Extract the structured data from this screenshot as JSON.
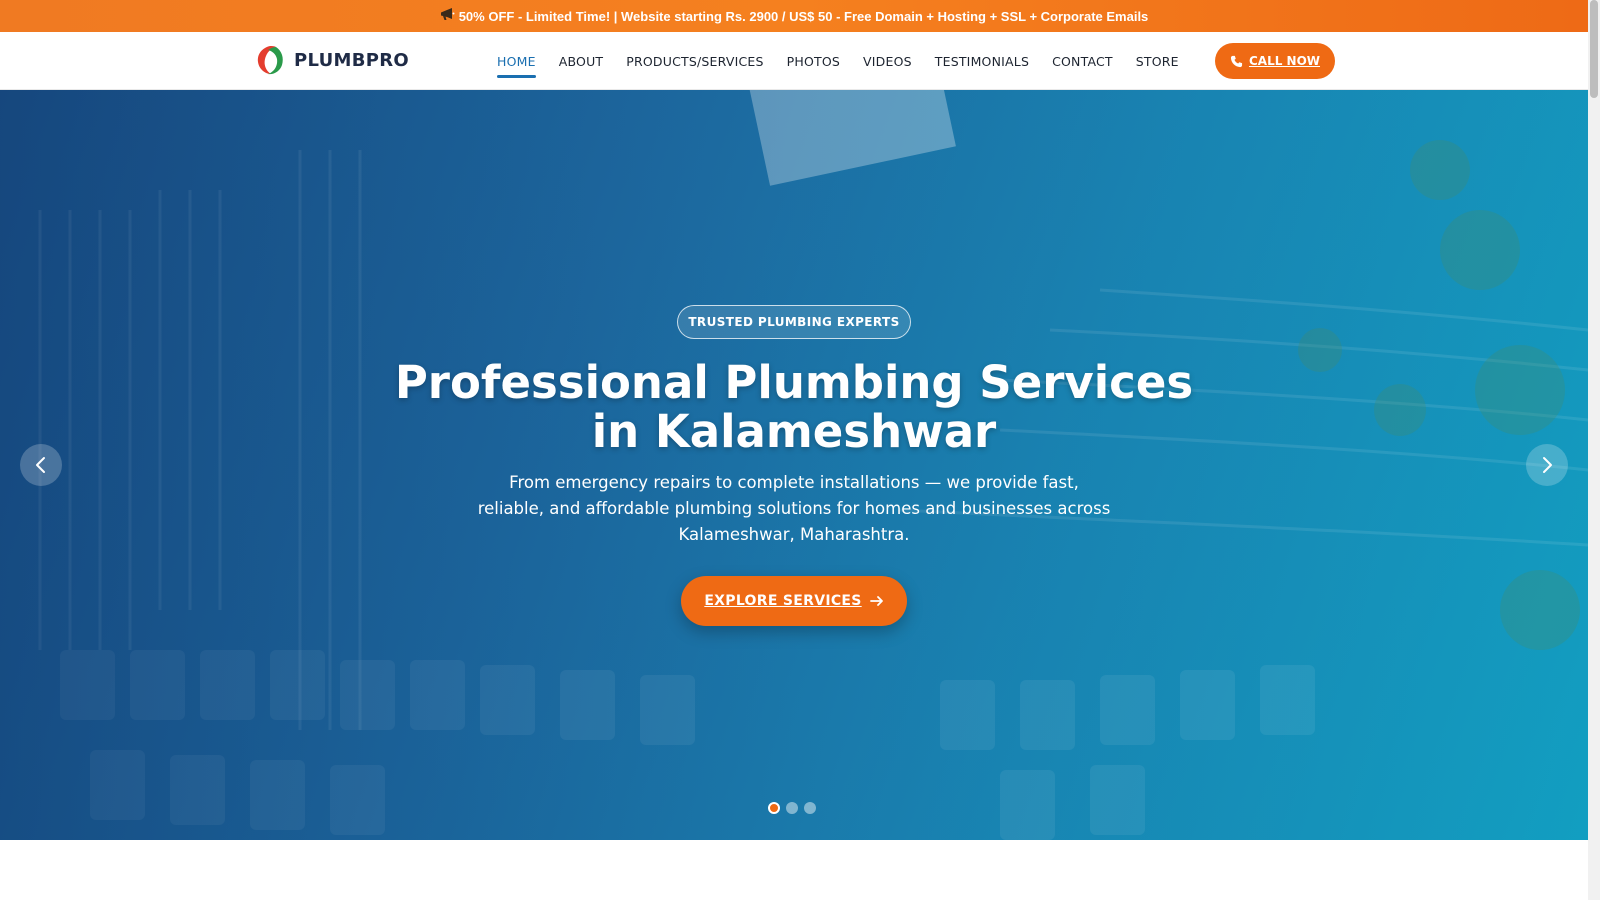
{
  "promo": {
    "icon": "megaphone-icon",
    "text": "50% OFF - Limited Time! | Website starting Rs. 2900 / US$ 50 - Free Domain + Hosting + SSL + Corporate Emails"
  },
  "header": {
    "logo_text": "PLUMBPRO",
    "nav": [
      {
        "label": "HOME",
        "active": true
      },
      {
        "label": "ABOUT"
      },
      {
        "label": "PRODUCTS/SERVICES"
      },
      {
        "label": "PHOTOS"
      },
      {
        "label": "VIDEOS"
      },
      {
        "label": "TESTIMONIALS"
      },
      {
        "label": "CONTACT"
      },
      {
        "label": "STORE"
      }
    ],
    "call_label": "CALL NOW",
    "call_icon": "phone-icon"
  },
  "hero": {
    "badge": "TRUSTED PLUMBING EXPERTS",
    "title": "Professional Plumbing Services in Kalameshwar",
    "subtitle": "From emergency repairs to complete installations — we provide fast, reliable, and affordable plumbing solutions for homes and businesses across Kalameshwar, Maharashtra.",
    "cta_label": "EXPLORE SERVICES",
    "cta_icon": "arrow-right-icon",
    "slides_total": 3,
    "active_slide": 1
  },
  "colors": {
    "accent": "#ef6a14",
    "nav_active": "#1a6fb0",
    "logo_text": "#1f2b46"
  }
}
